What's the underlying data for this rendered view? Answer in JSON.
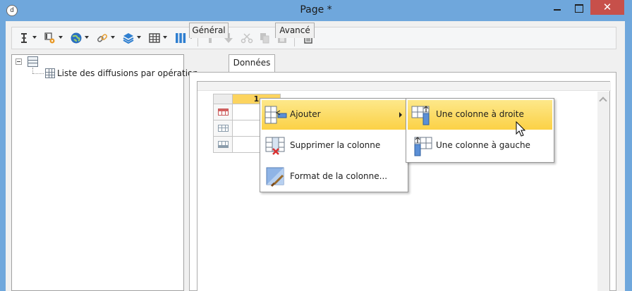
{
  "window": {
    "title": "Page *",
    "close_glyph": "✕",
    "app_icon_glyph": "d"
  },
  "toolbar": {
    "buttons": [
      {
        "name": "insert-field-icon",
        "has_dropdown": true
      },
      {
        "name": "insert-filter-icon",
        "has_dropdown": true
      },
      {
        "name": "globe-icon",
        "has_dropdown": true
      },
      {
        "name": "link-icon",
        "has_dropdown": true
      },
      {
        "name": "layers-icon",
        "has_dropdown": true
      },
      {
        "name": "table-icon",
        "has_dropdown": true
      },
      {
        "name": "columns-icon",
        "has_dropdown": true
      },
      {
        "name": "move-up-icon",
        "enabled": false
      },
      {
        "name": "move-down-icon",
        "enabled": false
      },
      {
        "name": "cut-icon",
        "enabled": false
      },
      {
        "name": "copy-icon",
        "enabled": false
      },
      {
        "name": "paste-icon",
        "enabled": false
      },
      {
        "name": "delete-icon",
        "enabled": true
      }
    ]
  },
  "tree": {
    "child_label": "Liste des diffusions par opération"
  },
  "tabs": [
    {
      "label": "Général",
      "active": false
    },
    {
      "label": "Données",
      "active": true
    },
    {
      "label": "Avancé",
      "active": false
    }
  ],
  "grid": {
    "column_header": "1",
    "rows": [
      "header-row",
      "body-row",
      "footer-row"
    ]
  },
  "context_menu": {
    "items": [
      {
        "label": "Ajouter",
        "has_submenu": true,
        "highlighted": true
      },
      {
        "label": "Supprimer la colonne",
        "has_submenu": false,
        "highlighted": false
      },
      {
        "label": "Format de la colonne...",
        "has_submenu": false,
        "highlighted": false
      }
    ]
  },
  "submenu": {
    "items": [
      {
        "label": "Une colonne à droite",
        "highlighted": true
      },
      {
        "label": "Une colonne à gauche",
        "highlighted": false
      }
    ]
  },
  "colors": {
    "title_bar": "#6fa7dc",
    "close_button": "#c7504a",
    "menu_highlight": "#fcd146",
    "column_header": "#fcd45f"
  }
}
